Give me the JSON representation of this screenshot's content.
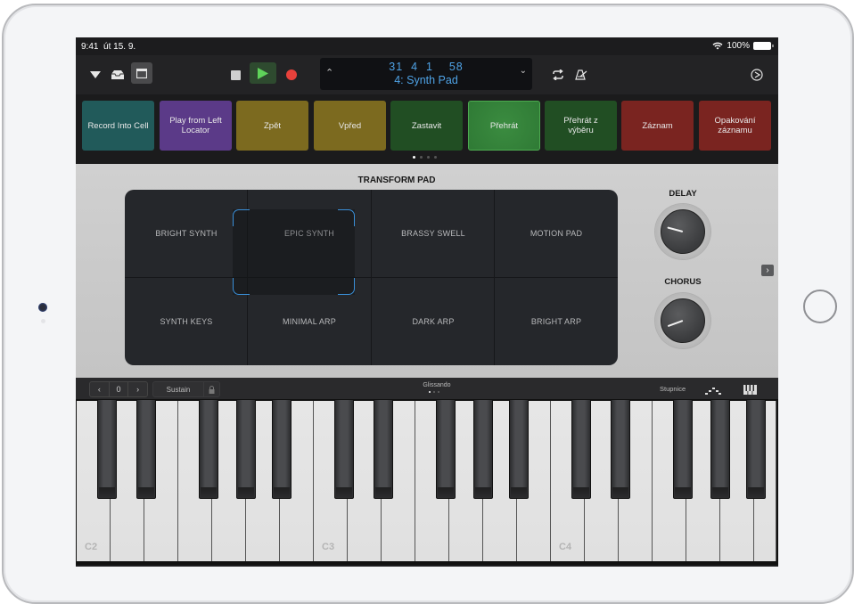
{
  "status_bar": {
    "time": "9:41",
    "date": "út 15. 9.",
    "battery_percent": "100%",
    "wifi_icon": "wifi-icon",
    "battery_icon": "battery-icon"
  },
  "control_bar": {
    "icons": [
      "browser-dropdown-icon",
      "library-icon",
      "view-toggle-icon",
      "stop-icon",
      "play-icon",
      "record-icon",
      "cycle-icon",
      "metronome-icon",
      "settings-icon"
    ],
    "lcd": {
      "position": "31  4  1    58",
      "track_name": "4: Synth Pad"
    },
    "colors": {
      "play": "#5fd35a",
      "record": "#e8413b",
      "lcd_text": "#4fa3e6"
    }
  },
  "cells": {
    "items": [
      {
        "label": "Record Into Cell",
        "color": "#215a5a"
      },
      {
        "label": "Play from Left Locator",
        "color": "#5b3a88"
      },
      {
        "label": "Zpět",
        "color": "#7c6a1f"
      },
      {
        "label": "Vpřed",
        "color": "#7c6a1f"
      },
      {
        "label": "Zastavit",
        "color": "#214e23"
      },
      {
        "label": "Přehrát",
        "color": "#2f7a35"
      },
      {
        "label": "Přehrát z výběru",
        "color": "#214e23"
      },
      {
        "label": "Záznam",
        "color": "#7a2420"
      },
      {
        "label": "Opakování záznamu",
        "color": "#7a2420"
      }
    ],
    "page_count": 4,
    "current_page": 1
  },
  "transform_pad": {
    "title": "TRANSFORM PAD",
    "cells": [
      "BRIGHT SYNTH",
      "EPIC SYNTH",
      "BRASSY SWELL",
      "MOTION PAD",
      "SYNTH KEYS",
      "MINIMAL ARP",
      "DARK ARP",
      "BRIGHT ARP"
    ],
    "selected": "EPIC SYNTH",
    "accent_color": "#3a8fd8"
  },
  "knobs": [
    {
      "label": "DELAY",
      "value_fraction": 0.12
    },
    {
      "label": "CHORUS",
      "value_fraction": 0.06
    }
  ],
  "keyboard_bar": {
    "octave_down": "‹",
    "octave_value": "0",
    "octave_up": "›",
    "sustain_label": "Sustain",
    "glissando_label": "Glissando",
    "glissando_pages": 3,
    "scale_label": "Stupnice"
  },
  "keyboard": {
    "note_labels": [
      "C2",
      "C3",
      "C4"
    ],
    "white_key_count": 21
  }
}
